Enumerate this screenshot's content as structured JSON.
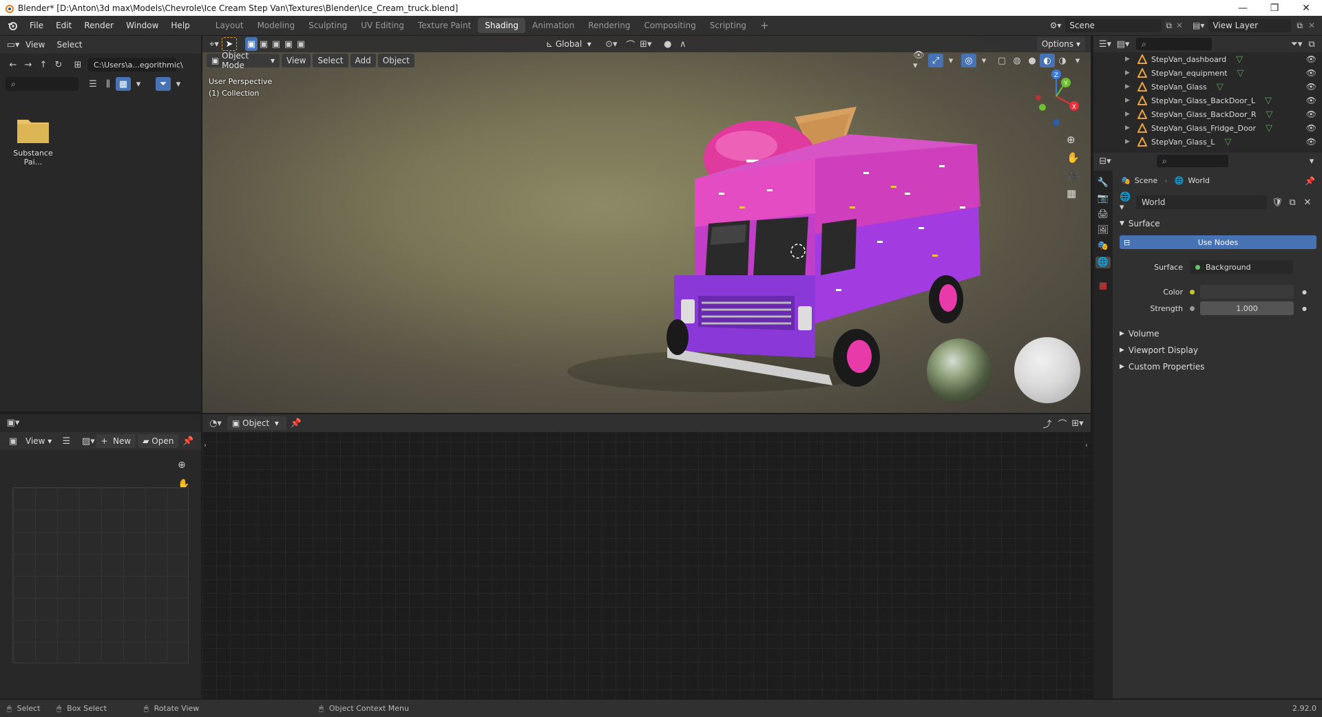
{
  "window": {
    "title": "Blender* [D:\\Anton\\3d max\\Models\\Chevrole\\Ice Cream Step Van\\Textures\\Blender\\Ice_Cream_truck.blend]",
    "minimize": "—",
    "restore": "❐",
    "close": "✕"
  },
  "menubar": {
    "items": [
      "File",
      "Edit",
      "Render",
      "Window",
      "Help"
    ],
    "workspaces": [
      "Layout",
      "Modeling",
      "Sculpting",
      "UV Editing",
      "Texture Paint",
      "Shading",
      "Animation",
      "Rendering",
      "Compositing",
      "Scripting"
    ],
    "active_workspace": "Shading",
    "add_tab": "+",
    "scene": "Scene",
    "view_layer": "View Layer"
  },
  "filebrowser": {
    "view": "View",
    "select": "Select",
    "path": "C:\\Users\\a...egorithmic\\",
    "folder_label": "Substance Pai..."
  },
  "viewport": {
    "mode": "Object Mode",
    "menu": [
      "View",
      "Select",
      "Add",
      "Object"
    ],
    "transform_orientation": "Global",
    "options": "Options",
    "overlay_line1": "User Perspective",
    "overlay_line2": "(1) Collection",
    "gizmo": {
      "x": "X",
      "y": "Y",
      "z": "Z"
    }
  },
  "imageeditor": {
    "view": "View",
    "new": "New",
    "open": "Open"
  },
  "nodeeditor": {
    "object": "Object"
  },
  "outliner": {
    "items": [
      "StepVan_dashboard",
      "StepVan_equipment",
      "StepVan_Glass",
      "StepVan_Glass_BackDoor_L",
      "StepVan_Glass_BackDoor_R",
      "StepVan_Glass_Fridge_Door",
      "StepVan_Glass_L"
    ]
  },
  "properties": {
    "breadcrumb_scene": "Scene",
    "breadcrumb_world": "World",
    "world_name": "World",
    "surface_panel": "Surface",
    "use_nodes": "Use Nodes",
    "surface_label": "Surface",
    "surface_value": "Background",
    "color_label": "Color",
    "strength_label": "Strength",
    "strength_value": "1.000",
    "panels": [
      "Volume",
      "Viewport Display",
      "Custom Properties"
    ],
    "colors": {
      "use_nodes_bg": "#4772b3",
      "surface_dot": "#63c763",
      "color_dot": "#c7c729"
    }
  },
  "statusbar": {
    "select": "Select",
    "box_select": "Box Select",
    "rotate_view": "Rotate View",
    "context_menu": "Object Context Menu",
    "version": "2.92.0"
  }
}
